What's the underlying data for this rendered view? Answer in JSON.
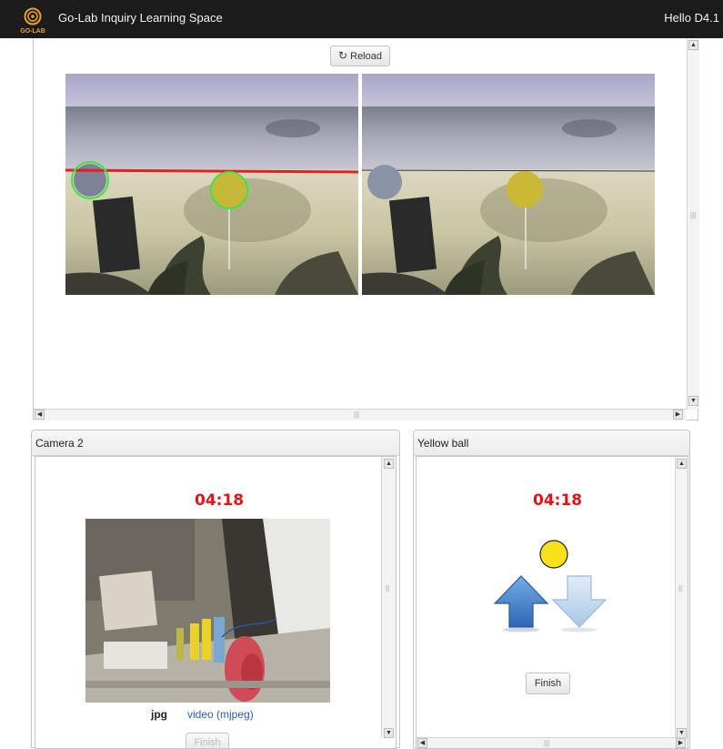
{
  "header": {
    "logo_text": "GO-LAB",
    "title": "Go-Lab Inquiry Learning Space",
    "greeting": "Hello D4.1"
  },
  "camera_view": {
    "reload_label": "Reload"
  },
  "camera2": {
    "title": "Camera 2",
    "timer": "04:18",
    "format_active": "jpg",
    "format_link": "video (mjpeg)",
    "button_partial": "Finish"
  },
  "yellow_ball": {
    "title": "Yellow ball",
    "timer": "04:18",
    "finish_label": "Finish",
    "ball_color": "#f6e11a",
    "arrow_color": "#3c7fd0"
  }
}
